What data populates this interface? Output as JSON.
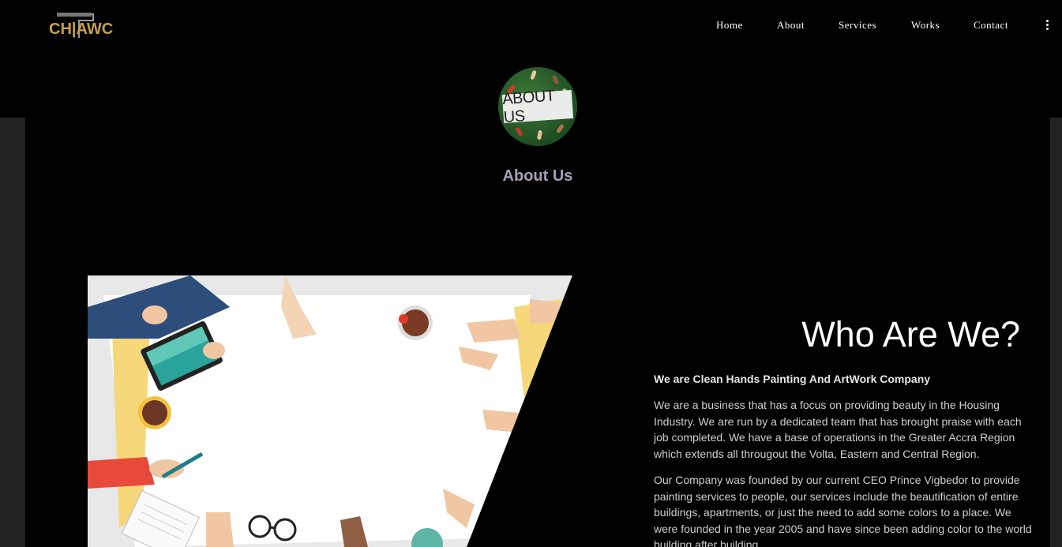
{
  "header": {
    "logo_text": "CH|AWC",
    "nav": [
      "Home",
      "About",
      "Services",
      "Works",
      "Contact"
    ]
  },
  "about": {
    "badge_text": "ABOUT US",
    "title": "About Us"
  },
  "content": {
    "heading": "Who Are We?",
    "subheading": "We are Clean Hands Painting And ArtWork Company",
    "paragraph1": "We are a business that has a focus on providing beauty in the Housing Industry. We are run by a dedicated team that has brought praise with each job completed. We have a base of operations in the Greater Accra Region which extends all througout the Volta, Eastern and Central Region.",
    "paragraph2": "Our Company was founded by our current CEO Prince Vigbedor to provide painting services to people, our services include the beautification of entire buildings, apartments, or just the need to add some colors to a place. We were founded in the year 2005 and have since been adding color to the world building after building."
  },
  "colors": {
    "accent_gold": "#c9a14a",
    "title_muted": "#a8a0b4"
  }
}
